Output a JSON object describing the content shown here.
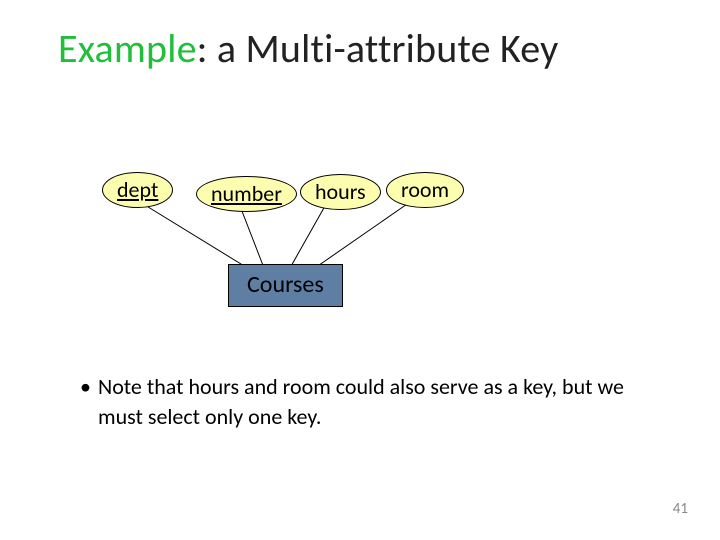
{
  "title": {
    "accent": "Example",
    "rest": ": a Multi-attribute Key"
  },
  "attrs": {
    "dept": {
      "label": "dept",
      "is_key": true
    },
    "number": {
      "label": "number",
      "is_key": true
    },
    "hours": {
      "label": "hours",
      "is_key": false
    },
    "room": {
      "label": "room",
      "is_key": false
    }
  },
  "entity": {
    "label": "Courses"
  },
  "note": "Note that hours and room could also serve as a key, but we must select only one key.",
  "page_number": "41",
  "colors": {
    "accent": "#1fbf3a",
    "attr_fill": "#fdfdaf",
    "entity_fill": "#5e7fa3"
  }
}
